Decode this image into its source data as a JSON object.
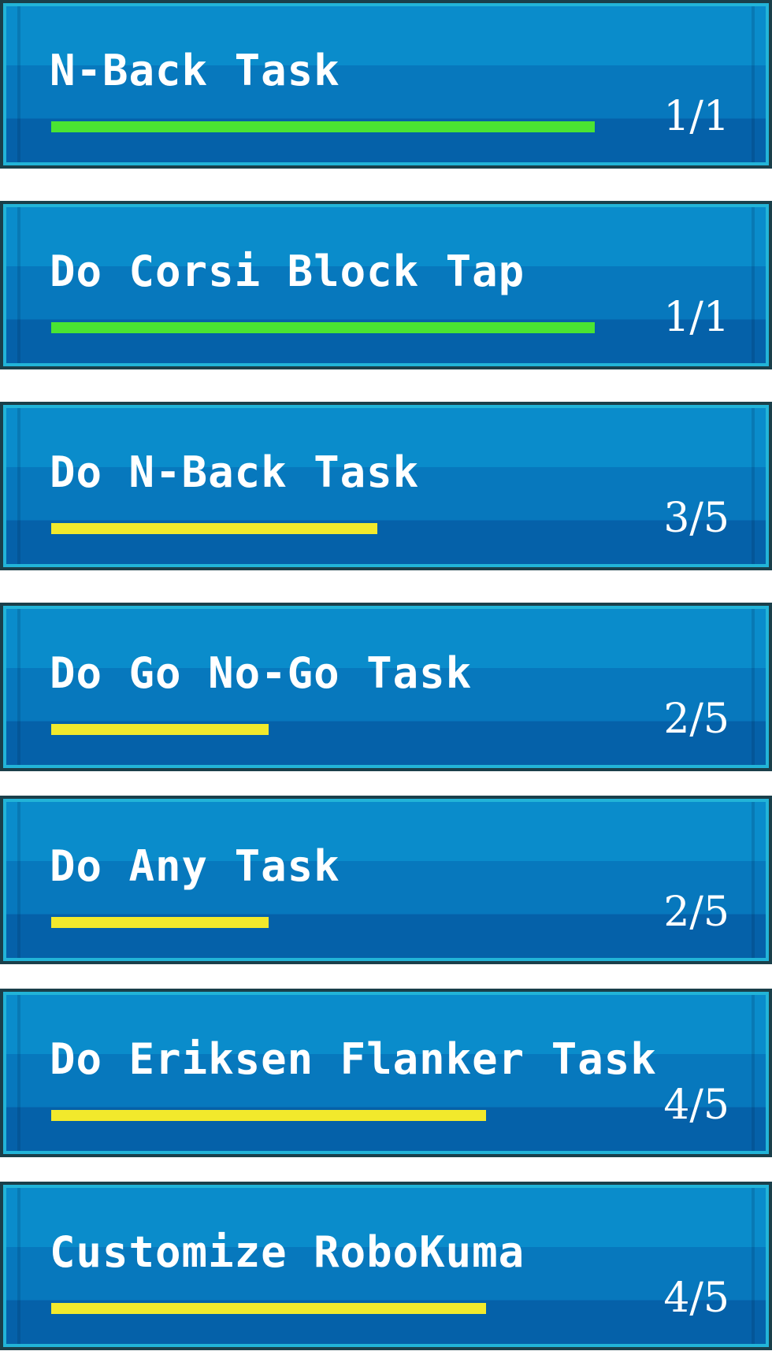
{
  "tasks": [
    {
      "title": "N-Back Task",
      "progress": "1/1",
      "done": 1,
      "total": 1
    },
    {
      "title": "Do Corsi Block Tap",
      "progress": "1/1",
      "done": 1,
      "total": 1
    },
    {
      "title": "Do N-Back Task",
      "progress": "3/5",
      "done": 3,
      "total": 5
    },
    {
      "title": "Do Go No-Go Task",
      "progress": "2/5",
      "done": 2,
      "total": 5
    },
    {
      "title": "Do Any Task",
      "progress": "2/5",
      "done": 2,
      "total": 5
    },
    {
      "title": "Do Eriksen Flanker Task",
      "progress": "4/5",
      "done": 4,
      "total": 5
    },
    {
      "title": "Customize RoboKuma",
      "progress": "4/5",
      "done": 4,
      "total": 5
    }
  ],
  "colors": {
    "complete": "#4ae432",
    "partial": "#f2e92c",
    "panel": "#0a8ccb",
    "border": "#22b4d8"
  }
}
